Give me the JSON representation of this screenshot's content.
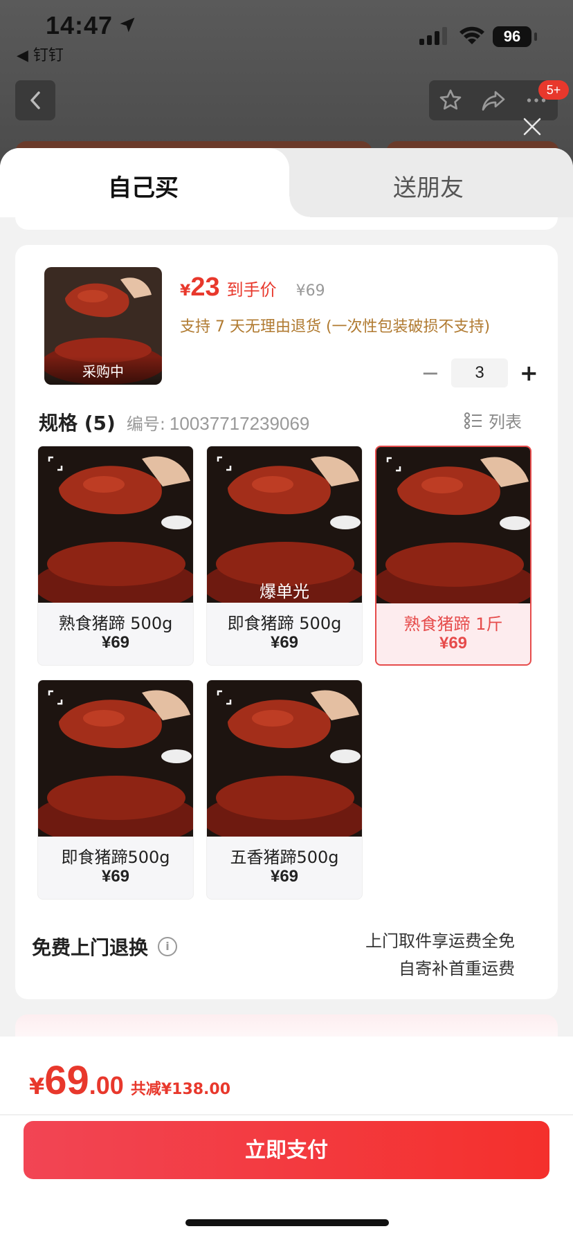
{
  "status_bar": {
    "time": "14:47",
    "back_app": "◀ 钉钉",
    "battery": "96"
  },
  "nav": {
    "badge": "5+"
  },
  "tabs": [
    {
      "label": "自己买",
      "active": true
    },
    {
      "label": "送朋友",
      "active": false
    }
  ],
  "product": {
    "thumb_tag": "采购中",
    "price_yen": "¥",
    "price": "23",
    "price_label": "到手价",
    "original_price": "¥69",
    "return_note": "支持 7 天无理由退货 (一次性包装破损不支持)",
    "quantity": "3",
    "minus": "−",
    "plus": "+"
  },
  "spec": {
    "title": "规格 (5)",
    "code_label": "编号:",
    "code": "10037717239069",
    "view_label": "列表"
  },
  "skus": [
    {
      "name": "熟食猪蹄 500g",
      "price": "¥69",
      "selected": false,
      "overlay": ""
    },
    {
      "name": "即食猪蹄 500g",
      "price": "¥69",
      "selected": false,
      "overlay": "爆单光"
    },
    {
      "name": "熟食猪蹄 1斤",
      "price": "¥69",
      "selected": true,
      "overlay": ""
    },
    {
      "name": "即食猪蹄500g",
      "price": "¥69",
      "selected": false,
      "overlay": ""
    },
    {
      "name": "五香猪蹄500g",
      "price": "¥69",
      "selected": false,
      "overlay": ""
    }
  ],
  "free_return": {
    "title": "免费上门退换",
    "note_line1": "上门取件享运费全免",
    "note_line2": "自寄补首重运费"
  },
  "footer": {
    "total_yen": "¥",
    "total_int": "69",
    "total_dec": ".00",
    "discount": "共减¥138.00",
    "pay_label": "立即支付"
  },
  "colors": {
    "accent": "#e8382c",
    "selected_border": "#e64b4b",
    "note_orange": "#b07a30"
  }
}
